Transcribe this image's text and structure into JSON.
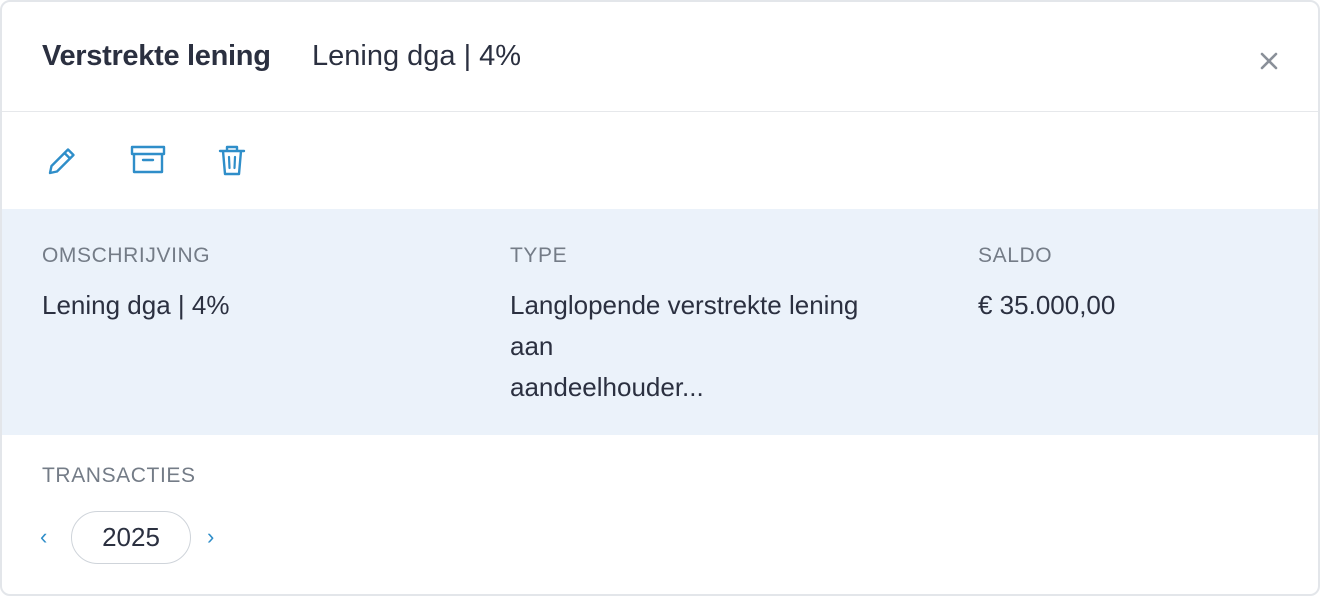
{
  "header": {
    "title_bold": "Verstrekte lening",
    "title_rest": "Lening dga | 4%",
    "close_icon": "close-icon"
  },
  "toolbar": {
    "edit_icon": "pencil-icon",
    "archive_icon": "archive-box-icon",
    "delete_icon": "trash-icon",
    "icon_color": "#2f8ec9"
  },
  "details": {
    "background": "#ebf2fa",
    "omschrijving": {
      "label": "OMSCHRIJVING",
      "value": "Lening dga | 4%"
    },
    "type": {
      "label": "TYPE",
      "value_line1": "Langlopende verstrekte lening",
      "value_line2": "aan",
      "value_line3": "aandeelhouder..."
    },
    "saldo": {
      "label": "SALDO",
      "value": "€ 35.000,00"
    }
  },
  "transactions": {
    "label": "TRANSACTIES",
    "prev": "‹",
    "next": "›",
    "year": "2025"
  }
}
